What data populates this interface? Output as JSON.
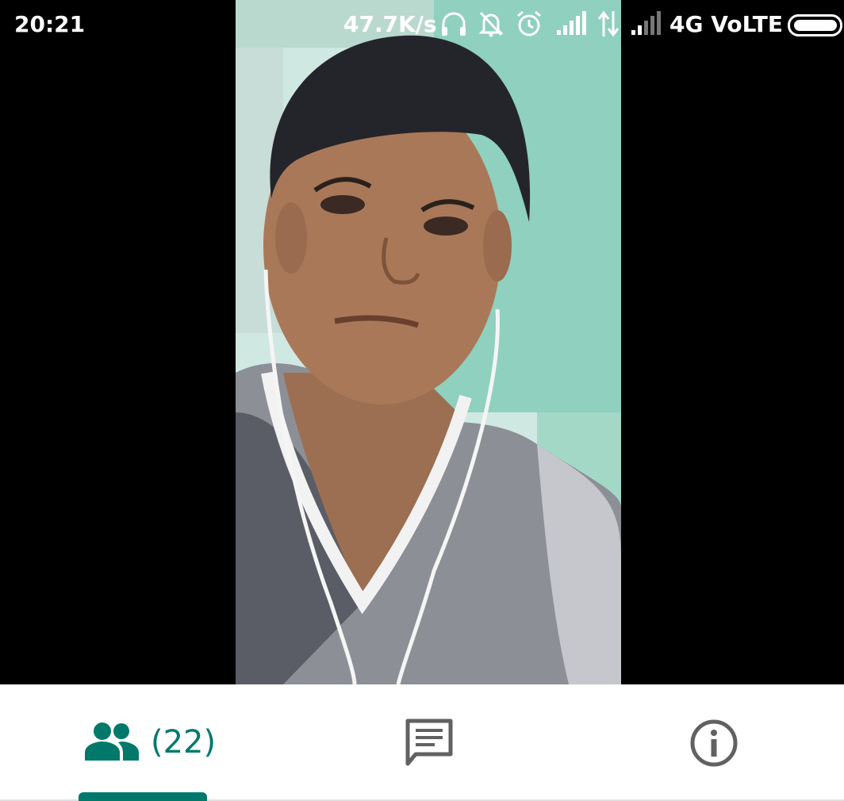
{
  "status_bar": {
    "time": "20:21",
    "network_speed": "47.7K/s",
    "network_label": "4G VoLTE",
    "icons": [
      "headphones-icon",
      "bell-off-icon",
      "alarm-icon",
      "signal-icon",
      "data-arrows-icon",
      "signal-icon",
      "battery-icon"
    ]
  },
  "video": {
    "description_icon": "participant-video"
  },
  "bottom_bar": {
    "people_count": "(22)",
    "tabs": [
      {
        "name": "people",
        "icon": "people-icon",
        "active": true
      },
      {
        "name": "chat",
        "icon": "chat-icon",
        "active": false
      },
      {
        "name": "info",
        "icon": "info-icon",
        "active": false
      }
    ]
  },
  "colors": {
    "accent": "#00796b",
    "icon_gray": "#616161",
    "bar_bg": "#ffffff"
  }
}
